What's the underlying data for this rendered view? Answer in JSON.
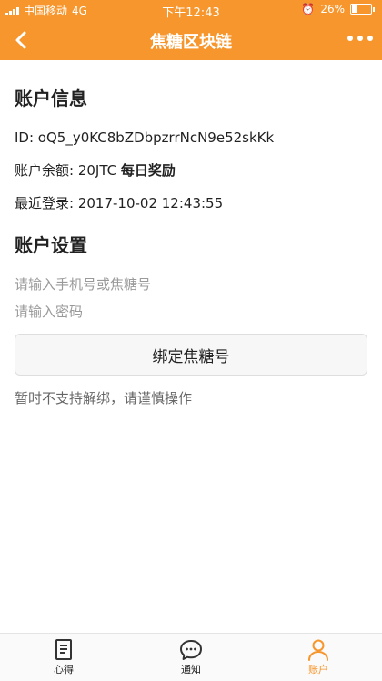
{
  "status_bar": {
    "carrier": "中国移动",
    "network": "4G",
    "time": "下午12:43",
    "battery": "26%"
  },
  "navbar": {
    "title": "焦糖区块链",
    "back_icon": "chevron-left-icon",
    "more_icon": "more-dots-icon"
  },
  "account_info": {
    "heading": "账户信息",
    "id_line": "ID: oQ5_y0KC8bZDbpzrrNcN9e52skKk",
    "balance_prefix": "账户余额: 20JTC",
    "balance_link": "每日奖励",
    "last_login": "最近登录: 2017-10-02 12:43:55"
  },
  "account_settings": {
    "heading": "账户设置",
    "phone_placeholder": "请输入手机号或焦糖号",
    "password_placeholder": "请输入密码",
    "bind_button": "绑定焦糖号",
    "note": "暂时不支持解绑，请谨慎操作"
  },
  "tabbar": {
    "items": [
      {
        "label": "心得",
        "icon": "notebook-icon",
        "active": false
      },
      {
        "label": "通知",
        "icon": "chat-bubble-icon",
        "active": false
      },
      {
        "label": "账户",
        "icon": "user-icon",
        "active": true
      }
    ]
  },
  "colors": {
    "accent": "#f7962c"
  }
}
